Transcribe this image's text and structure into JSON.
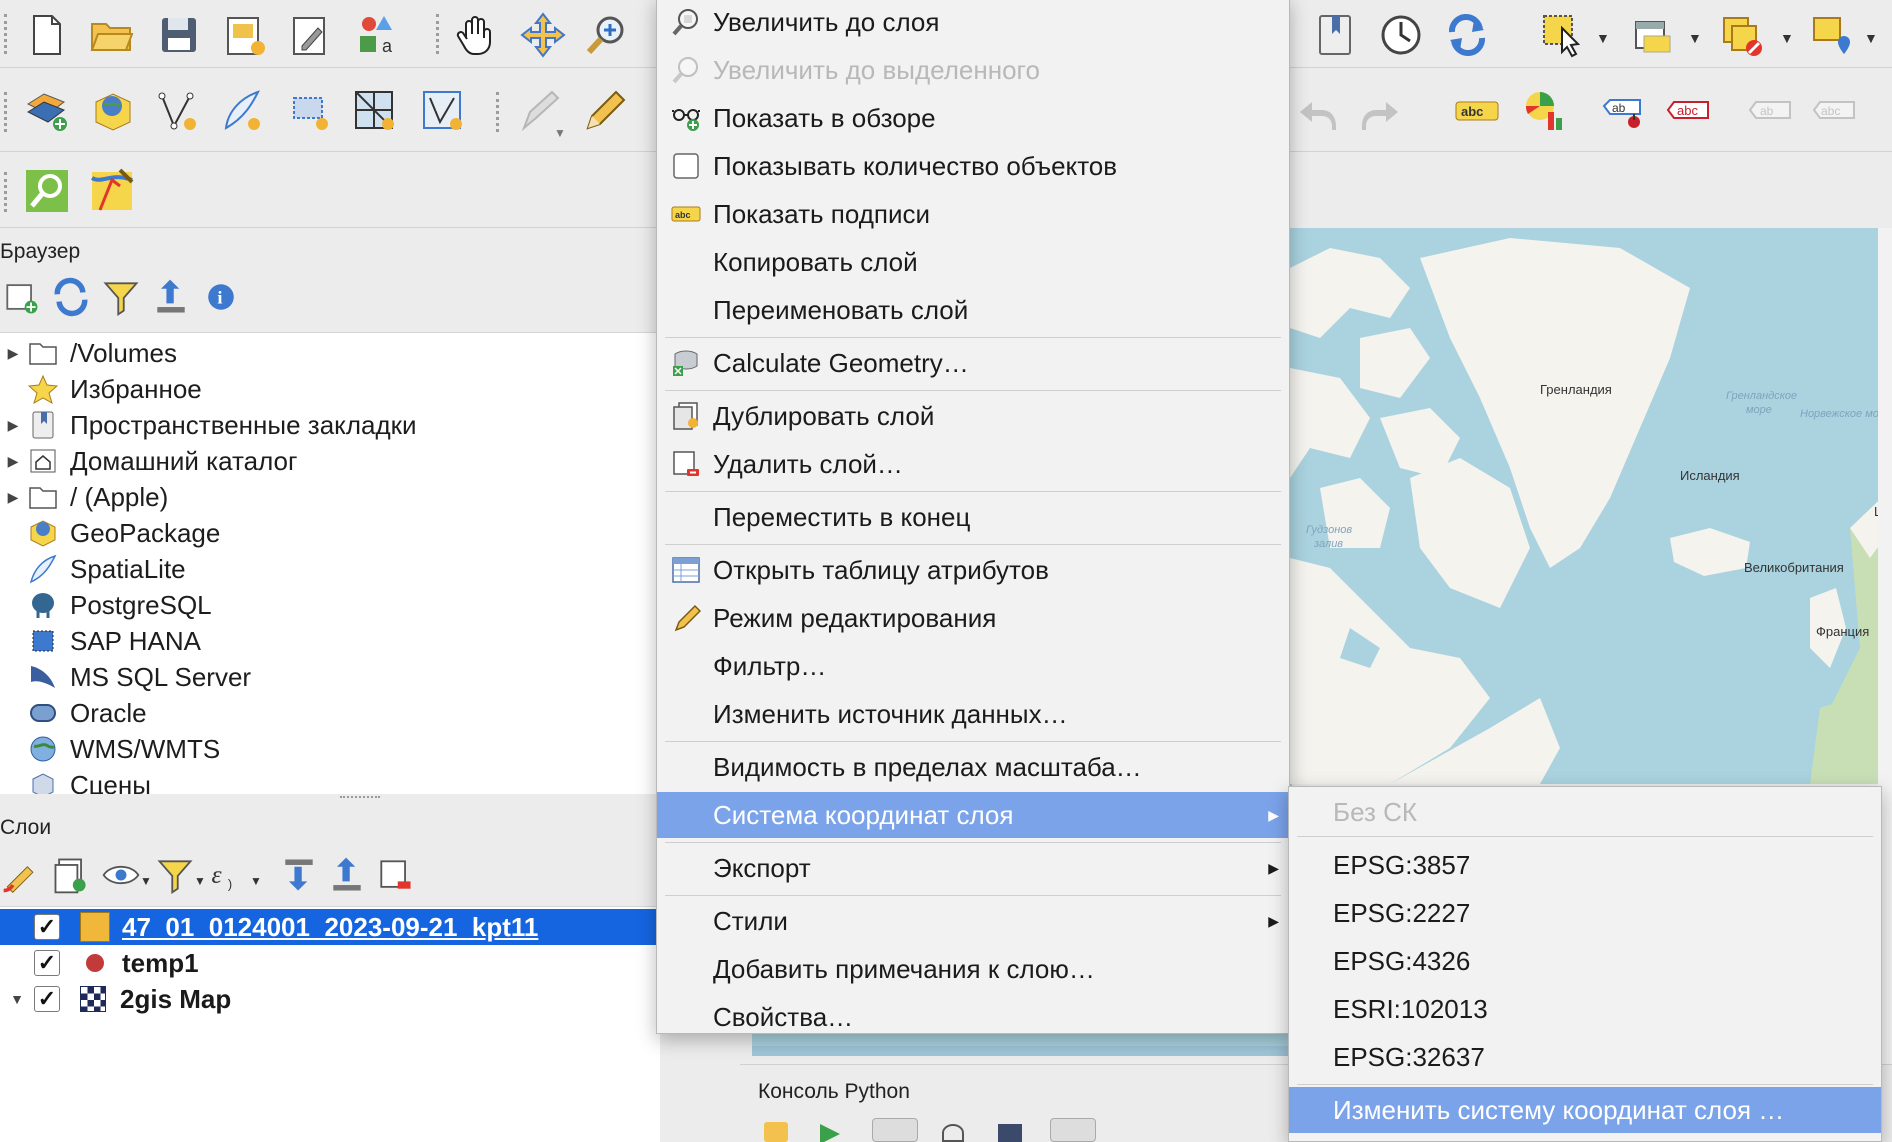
{
  "toolbar1": {
    "icons": [
      "new-project-icon",
      "open-project-icon",
      "save-project-icon",
      "new-print-layout-icon",
      "layout-manager-icon",
      "style-manager-icon",
      "pan-hand-icon",
      "pan-to-selection-icon",
      "zoom-in-icon",
      "bookmarks-icon",
      "clock-icon",
      "refresh-icon",
      "select-features-icon",
      "attribute-table-icon",
      "deselect-icon",
      "identify-icon"
    ]
  },
  "toolbar2": {
    "icons": [
      "add-layer-icon",
      "add-geopackage-icon",
      "digitize-icon",
      "add-vector-icon",
      "add-raster-icon",
      "add-mesh-icon",
      "add-vector-tile-icon",
      "edits-icon",
      "pencil-icon",
      "undo-icon",
      "redo-icon",
      "label-icon",
      "diagram-icon",
      "pin-label-icon",
      "label-toolbar-icon"
    ]
  },
  "browser": {
    "title": "Браузер",
    "items": [
      {
        "label": "/Volumes",
        "expandable": true,
        "icon": "folder-icon"
      },
      {
        "label": "Избранное",
        "expandable": false,
        "icon": "star-icon"
      },
      {
        "label": "Пространственные закладки",
        "expandable": true,
        "icon": "bookmark-icon"
      },
      {
        "label": "Домашний каталог",
        "expandable": true,
        "icon": "home-icon"
      },
      {
        "label": "/ (Apple)",
        "expandable": true,
        "icon": "folder-icon"
      },
      {
        "label": "GeoPackage",
        "expandable": false,
        "icon": "geopackage-icon"
      },
      {
        "label": "SpatiaLite",
        "expandable": false,
        "icon": "spatialite-icon"
      },
      {
        "label": "PostgreSQL",
        "expandable": false,
        "icon": "postgresql-icon"
      },
      {
        "label": "SAP HANA",
        "expandable": false,
        "icon": "sap-hana-icon"
      },
      {
        "label": "MS SQL Server",
        "expandable": false,
        "icon": "mssql-icon"
      },
      {
        "label": "Oracle",
        "expandable": false,
        "icon": "oracle-icon"
      },
      {
        "label": "WMS/WMTS",
        "expandable": false,
        "icon": "wms-icon"
      },
      {
        "label": "Сцены",
        "expandable": false,
        "icon": "scenes-icon"
      }
    ]
  },
  "layers": {
    "title": "Слои",
    "items": [
      {
        "label": "47_01_0124001_2023-09-21_kpt11",
        "checked": true,
        "selected": true,
        "swatch": "#f0b73a"
      },
      {
        "label": "temp1",
        "checked": true,
        "selected": false,
        "swatch": "#c23a3a"
      },
      {
        "label": "2gis Map",
        "checked": true,
        "selected": false,
        "swatch": "raster"
      }
    ]
  },
  "context_menu": {
    "items": [
      {
        "label": "Увеличить до слоя",
        "icon": "zoom-to-layer-icon",
        "disabled": false
      },
      {
        "label": "Увеличить до выделенного",
        "icon": "zoom-to-selection-icon",
        "disabled": true
      },
      {
        "label": "Показать в обзоре",
        "icon": "overview-icon",
        "disabled": false
      },
      {
        "label": "Показывать количество объектов",
        "icon": "checkbox-icon",
        "disabled": false
      },
      {
        "label": "Показать подписи",
        "icon": "labels-icon",
        "disabled": false
      },
      {
        "label": "Копировать слой",
        "icon": "",
        "disabled": false
      },
      {
        "label": "Переименовать слой",
        "icon": "",
        "disabled": false
      },
      {
        "label": "Calculate Geometry…",
        "icon": "calculate-geometry-icon",
        "disabled": false
      },
      {
        "label": "Дублировать слой",
        "icon": "duplicate-layer-icon",
        "disabled": false
      },
      {
        "label": "Удалить слой…",
        "icon": "remove-layer-icon",
        "disabled": false
      },
      {
        "label": "Переместить в конец",
        "icon": "",
        "disabled": false
      },
      {
        "label": "Открыть таблицу атрибутов",
        "icon": "attribute-table-icon",
        "disabled": false
      },
      {
        "label": "Режим редактирования",
        "icon": "pencil-icon",
        "disabled": false
      },
      {
        "label": "Фильтр…",
        "icon": "",
        "disabled": false
      },
      {
        "label": "Изменить источник данных…",
        "icon": "",
        "disabled": false
      },
      {
        "label": "Видимость в пределах масштаба…",
        "icon": "",
        "disabled": false
      },
      {
        "label": "Система координат слоя",
        "icon": "",
        "disabled": false,
        "highlighted": true,
        "submenu": true
      },
      {
        "label": "Экспорт",
        "icon": "",
        "disabled": false,
        "submenu": true
      },
      {
        "label": "Стили",
        "icon": "",
        "disabled": false,
        "submenu": true
      },
      {
        "label": "Добавить примечания к слою…",
        "icon": "",
        "disabled": false
      },
      {
        "label": "Свойства…",
        "icon": "",
        "disabled": false
      }
    ]
  },
  "crs_submenu": {
    "items": [
      {
        "label": "Без СК",
        "disabled": true
      },
      {
        "label": "EPSG:3857",
        "disabled": false
      },
      {
        "label": "EPSG:2227",
        "disabled": false
      },
      {
        "label": "EPSG:4326",
        "disabled": false
      },
      {
        "label": "ESRI:102013",
        "disabled": false
      },
      {
        "label": "EPSG:32637",
        "disabled": false
      },
      {
        "label": "Изменить систему координат слоя …",
        "disabled": false,
        "highlighted": true
      }
    ]
  },
  "map": {
    "labels": {
      "greenland": "Гренландия",
      "iceland": "Исландия",
      "uk": "Великобритания",
      "france": "Франция",
      "greenland_sea_1": "Гренландское",
      "greenland_sea_2": "море",
      "norwegian_sea": "Норвежское море",
      "hudson_bay_1": "Гудзонов",
      "hudson_bay_2": "залив",
      "sweden_partial": "Шв"
    },
    "colors": {
      "water": "#aad3df",
      "land": "#f5f3ee",
      "green": "#c8dfb6"
    }
  },
  "python_console": {
    "title": "Консоль Python"
  },
  "colors": {
    "selection": "#1565e0",
    "menu_highlight": "#7ba3ea"
  }
}
